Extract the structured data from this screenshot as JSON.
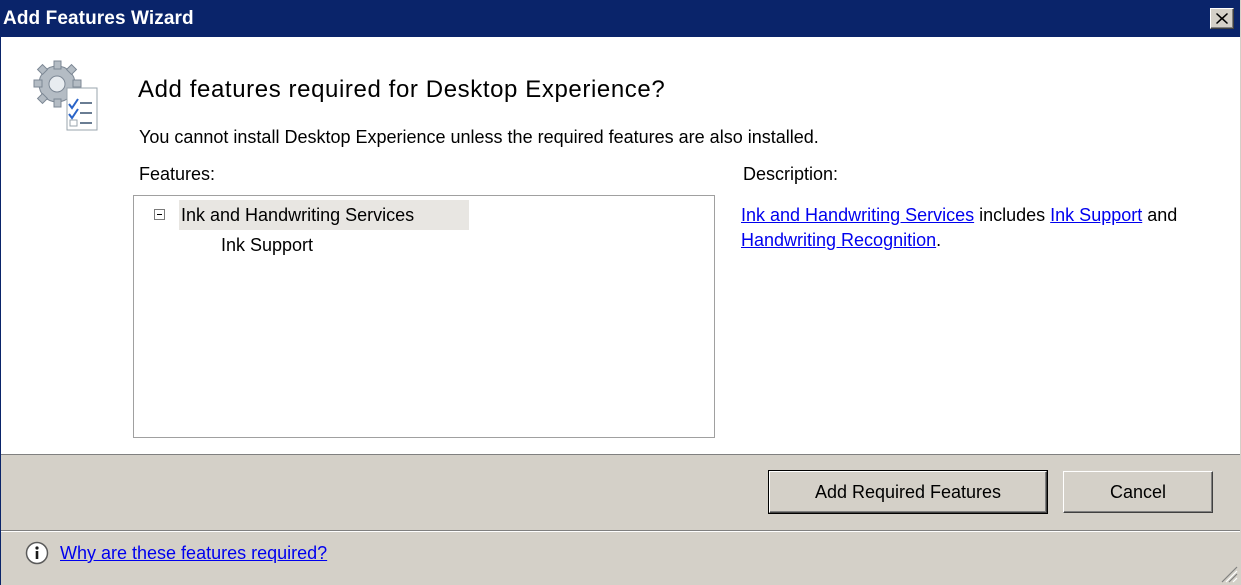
{
  "window": {
    "title": "Add Features Wizard"
  },
  "header": {
    "heading": "Add features required for Desktop Experience?",
    "subtitle": "You cannot install Desktop Experience unless the required features are also installed."
  },
  "features": {
    "label": "Features:",
    "tree": [
      {
        "label": "Ink and Handwriting Services",
        "expanded": true,
        "children": [
          {
            "label": "Ink Support"
          }
        ]
      }
    ]
  },
  "description": {
    "label": "Description:",
    "link_ink_handwriting": "Ink and Handwriting Services",
    "text_includes": " includes ",
    "link_ink_support": "Ink Support",
    "text_and": " and ",
    "link_handwriting_recognition": "Handwriting Recognition",
    "text_period": "."
  },
  "buttons": {
    "add_required": "Add Required Features",
    "cancel": "Cancel"
  },
  "footer": {
    "why_link": "Why are these features required?"
  },
  "icons": {
    "close": "close-icon",
    "header": "wizard-checklist-gear-icon",
    "expander": "tree-collapse-icon",
    "info": "info-icon",
    "grip": "resize-grip-icon"
  },
  "colors": {
    "titlebar": "#0a246a",
    "link": "#0000ee",
    "footer_bg": "#d4d0c8",
    "selected_row": "#e8e6e2"
  }
}
